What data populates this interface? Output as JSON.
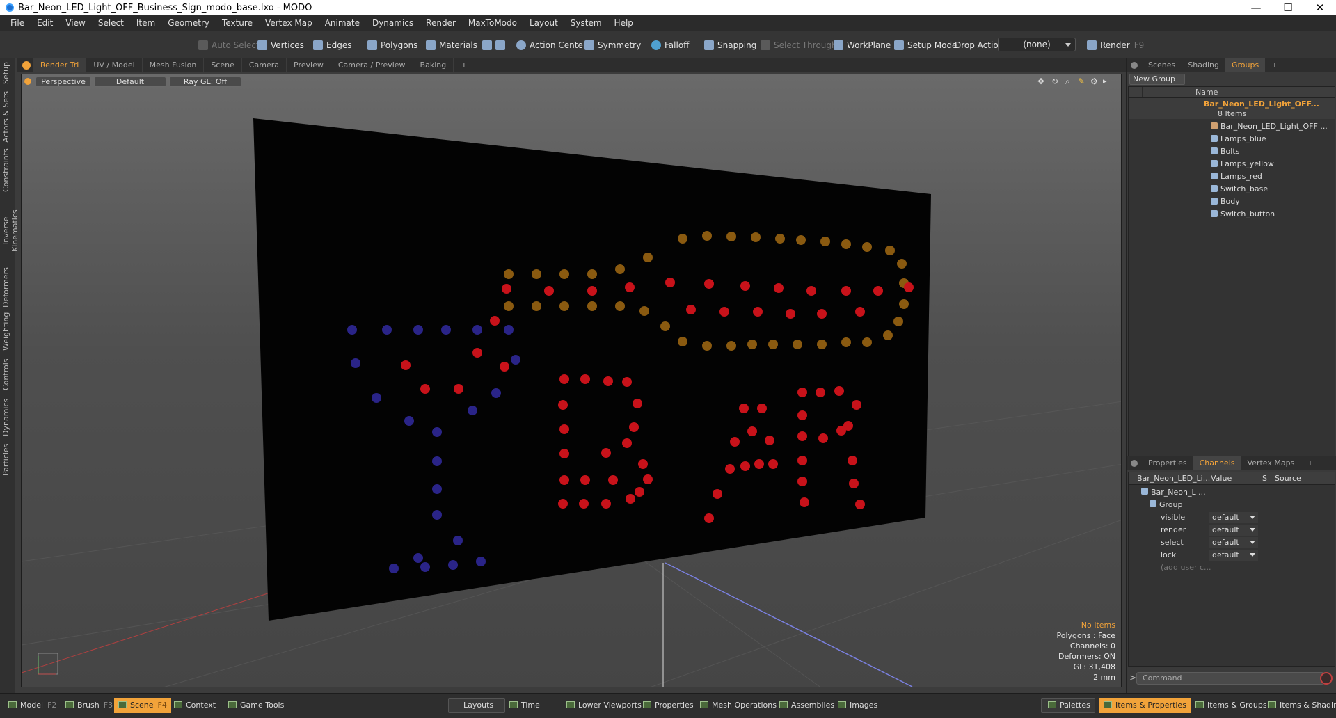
{
  "window": {
    "title": "Bar_Neon_LED_Light_OFF_Business_Sign_modo_base.lxo - MODO",
    "minimize": "—",
    "maximize": "☐",
    "close": "✕"
  },
  "menu": [
    "File",
    "Edit",
    "View",
    "Select",
    "Item",
    "Geometry",
    "Texture",
    "Vertex Map",
    "Animate",
    "Dynamics",
    "Render",
    "MaxToModo",
    "Layout",
    "System",
    "Help"
  ],
  "toolbar": {
    "auto_select": "Auto Select",
    "vertices": "Vertices",
    "edges": "Edges",
    "polygons": "Polygons",
    "materials": "Materials",
    "action_center": "Action Center",
    "symmetry": "Symmetry",
    "falloff": "Falloff",
    "snapping": "Snapping",
    "select_through": "Select Through",
    "workplane": "WorkPlane",
    "setup_mode": "Setup Mode",
    "drop_action": "Drop Action",
    "drop_value": "(none)",
    "render": "Render",
    "render_key": "F9"
  },
  "left_tabs": [
    "Setup",
    "Actors & Sets",
    "Constraints",
    "Inverse Kinematics",
    "Deformers",
    "Weighting",
    "Controls",
    "Dynamics",
    "Particles"
  ],
  "view_tabs": [
    "Render Tri",
    "UV / Model",
    "Mesh Fusion",
    "Scene",
    "Camera",
    "Preview",
    "Camera / Preview",
    "Baking",
    "+"
  ],
  "viewport": {
    "perspective": "Perspective",
    "default": "Default",
    "raygl": "Ray GL: Off"
  },
  "info": {
    "no_items": "No Items",
    "polygons": "Polygons : Face",
    "channels": "Channels: 0",
    "deformers": "Deformers: ON",
    "gl": "GL: 31,408",
    "scale": "2 mm"
  },
  "right_tabs": [
    "Scenes",
    "Shading",
    "Groups",
    "+"
  ],
  "groups": {
    "new_group": "New Group",
    "name_header": "Name",
    "root": "Bar_Neon_LED_Light_OFF...",
    "count": "8 Items",
    "items": [
      "Bar_Neon_LED_Light_OFF ...",
      "Lamps_blue",
      "Bolts",
      "Lamps_yellow",
      "Lamps_red",
      "Switch_base",
      "Body",
      "Switch_button"
    ]
  },
  "bottom_tabs": [
    "Properties",
    "Channels",
    "Vertex Maps",
    "+"
  ],
  "channels": {
    "col_name": "Bar_Neon_LED_Li...",
    "col_value": "Value",
    "col_s": "S",
    "col_source": "Source",
    "root": "Bar_Neon_L ...",
    "group": "Group",
    "rows": [
      {
        "name": "visible",
        "value": "default"
      },
      {
        "name": "render",
        "value": "default"
      },
      {
        "name": "select",
        "value": "default"
      },
      {
        "name": "lock",
        "value": "default"
      }
    ],
    "add_user": "(add user c..."
  },
  "command_placeholder": "Command",
  "statusbar": {
    "model": "Model",
    "model_key": "F2",
    "brush": "Brush",
    "brush_key": "F3",
    "scene": "Scene",
    "scene_key": "F4",
    "context": "Context",
    "game_tools": "Game Tools",
    "layouts": "Layouts",
    "time": "Time",
    "lower_viewports": "Lower Viewports",
    "properties": "Properties",
    "mesh_operations": "Mesh Operations",
    "assemblies": "Assemblies",
    "images": "Images",
    "palettes": "Palettes",
    "items_properties": "Items & Properties",
    "items_groups": "Items & Groups",
    "items_shading": "Items & Shading"
  },
  "colors": {
    "accent": "#f2a33a",
    "lamp_red": "#c8121a",
    "lamp_blue": "#2a2488",
    "lamp_yellow": "#8a5a10"
  }
}
